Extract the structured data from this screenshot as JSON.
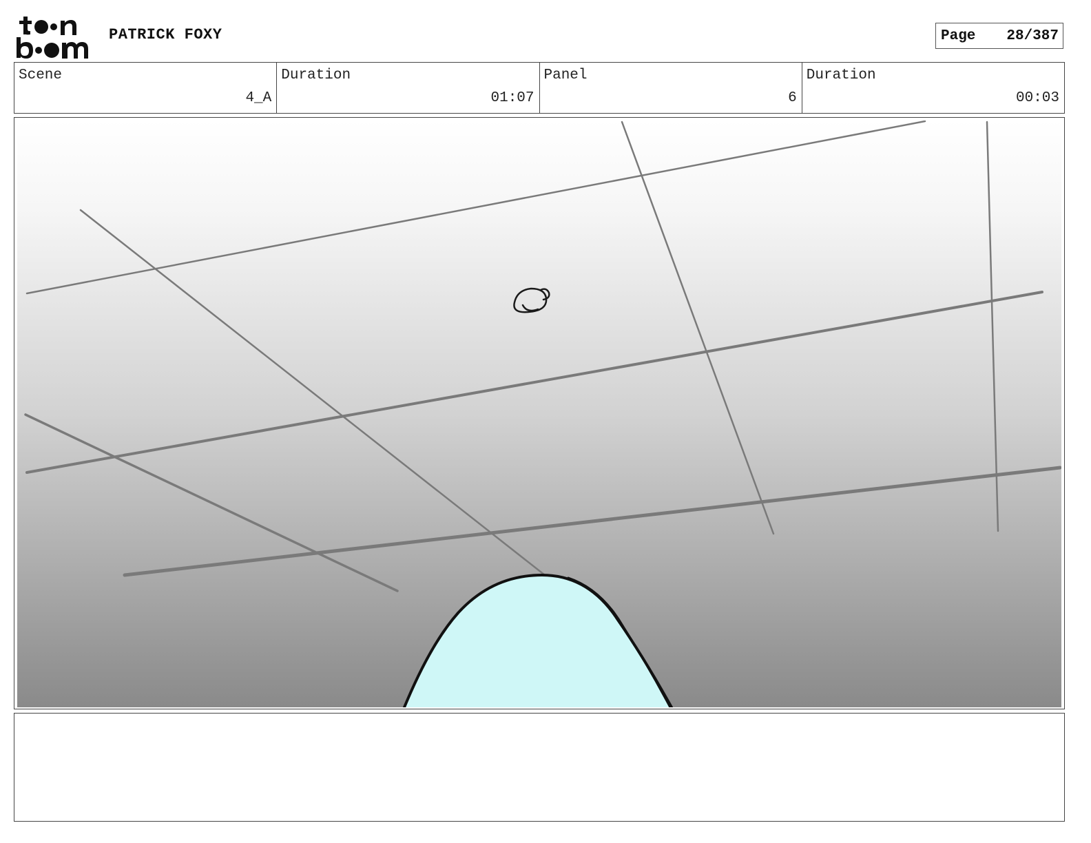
{
  "header": {
    "logo_text": "toonboom",
    "project_title": "PATRICK FOXY",
    "page_label": "Page",
    "page_number": "28/387"
  },
  "info": [
    {
      "label": "Scene",
      "value": "4_A"
    },
    {
      "label": "Duration",
      "value": "01:07"
    },
    {
      "label": "Panel",
      "value": "6"
    },
    {
      "label": "Duration",
      "value": "00:03"
    }
  ],
  "panel": {
    "description": "",
    "colors": {
      "gradient_top": "#ffffff",
      "gradient_bottom": "#8a8a8a",
      "grid_lines": "#7a7a7a",
      "dome_fill": "#cff7f7",
      "dome_outline": "#111111"
    }
  },
  "notes": {
    "text": ""
  }
}
